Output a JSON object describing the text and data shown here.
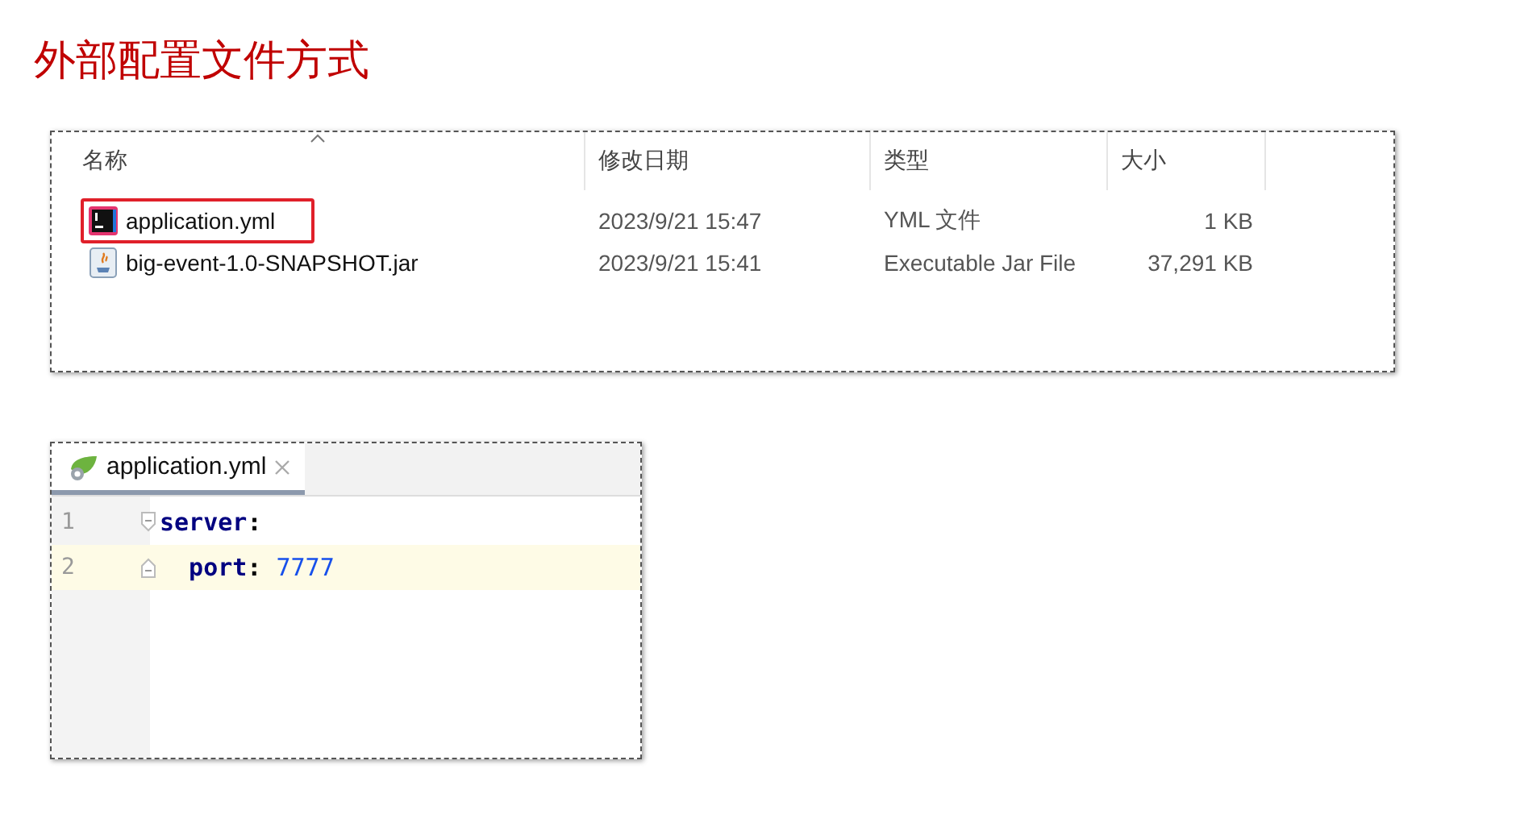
{
  "title": "外部配置文件方式",
  "explorer": {
    "columns": [
      {
        "label": "名称",
        "sorted": true
      },
      {
        "label": "修改日期",
        "sorted": false
      },
      {
        "label": "类型",
        "sorted": false
      },
      {
        "label": "大小",
        "sorted": false
      }
    ],
    "rows": [
      {
        "kind": "yml",
        "name": "application.yml",
        "date": "2023/9/21 15:47",
        "type": "YML 文件",
        "size": "1 KB",
        "highlighted": true
      },
      {
        "kind": "jar",
        "name": "big-event-1.0-SNAPSHOT.jar",
        "date": "2023/9/21 15:41",
        "type": "Executable Jar File",
        "size": "37,291 KB",
        "highlighted": false
      }
    ]
  },
  "editor": {
    "tab": {
      "label": "application.yml",
      "selected": true
    },
    "lines": [
      {
        "number": "1",
        "key": "server",
        "separator": ":",
        "current": false,
        "children": [
          {
            "number": "2",
            "key": "port",
            "separator": ":",
            "value": "7777",
            "current": true
          }
        ]
      }
    ]
  }
}
